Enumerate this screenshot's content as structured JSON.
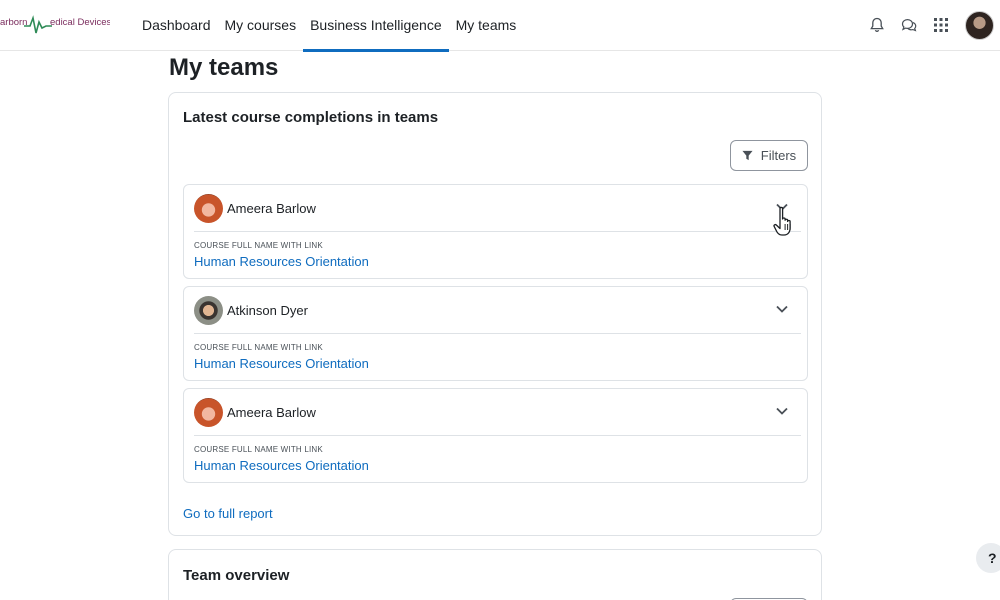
{
  "brand": {
    "logo_text_left": "arborn",
    "logo_text_right": "edical Devices",
    "colors": {
      "logo": "#7b2d5e",
      "logo_wave": "#2e8b57",
      "accent": "#0f6cbf"
    }
  },
  "nav": {
    "items": [
      {
        "label": "Dashboard",
        "active": false
      },
      {
        "label": "My courses",
        "active": false
      },
      {
        "label": "Business Intelligence",
        "active": true
      },
      {
        "label": "My teams",
        "active": false
      }
    ],
    "icons": [
      "bell-icon",
      "chat-icon",
      "apps-grid-icon",
      "user-avatar"
    ]
  },
  "page": {
    "title": "My teams"
  },
  "completions_card": {
    "title": "Latest course completions in teams",
    "filters_label": "Filters",
    "items": [
      {
        "name": "Ameera Barlow",
        "field_label": "COURSE FULL NAME WITH LINK",
        "course": "Human Resources Orientation",
        "avatar": "girl"
      },
      {
        "name": "Atkinson Dyer",
        "field_label": "COURSE FULL NAME WITH LINK",
        "course": "Human Resources Orientation",
        "avatar": "man"
      },
      {
        "name": "Ameera Barlow",
        "field_label": "COURSE FULL NAME WITH LINK",
        "course": "Human Resources Orientation",
        "avatar": "girl"
      }
    ],
    "report_link": "Go to full report"
  },
  "team_card": {
    "title": "Team overview"
  },
  "help": {
    "label": "?"
  }
}
